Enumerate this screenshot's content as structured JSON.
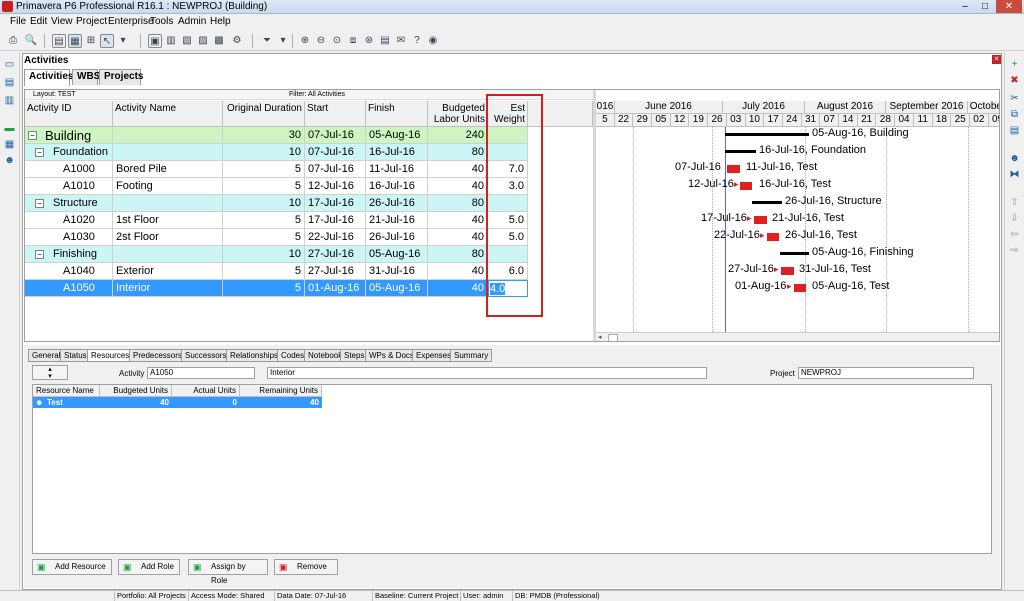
{
  "window": {
    "title": "Primavera P6 Professional R16.1 : NEWPROJ (Building)"
  },
  "menu": [
    "File",
    "Edit",
    "View",
    "Project",
    "Enterprise",
    "Tools",
    "Admin",
    "Help"
  ],
  "panel": {
    "title": "Activities"
  },
  "tabs": [
    "Activities",
    "WBS",
    "Projects"
  ],
  "layout": {
    "label": "Layout: TEST",
    "filter": "Filter: All Activities"
  },
  "columns": {
    "id": "Activity ID",
    "name": "Activity Name",
    "dur": "Original Duration",
    "start": "Start",
    "finish": "Finish",
    "units": "Budgeted Labor Units",
    "weight": "Est Weight"
  },
  "rows": [
    {
      "id": "Building",
      "name": "",
      "dur": "30",
      "start": "07-Jul-16",
      "finish": "05-Aug-16",
      "units": "240",
      "weight": ""
    },
    {
      "id": "Foundation",
      "name": "",
      "dur": "10",
      "start": "07-Jul-16",
      "finish": "16-Jul-16",
      "units": "80",
      "weight": ""
    },
    {
      "id": "A1000",
      "name": "Bored Pile",
      "dur": "5",
      "start": "07-Jul-16",
      "finish": "11-Jul-16",
      "units": "40",
      "weight": "7.0"
    },
    {
      "id": "A1010",
      "name": "Footing",
      "dur": "5",
      "start": "12-Jul-16",
      "finish": "16-Jul-16",
      "units": "40",
      "weight": "3.0"
    },
    {
      "id": "Structure",
      "name": "",
      "dur": "10",
      "start": "17-Jul-16",
      "finish": "26-Jul-16",
      "units": "80",
      "weight": ""
    },
    {
      "id": "A1020",
      "name": "1st Floor",
      "dur": "5",
      "start": "17-Jul-16",
      "finish": "21-Jul-16",
      "units": "40",
      "weight": "5.0"
    },
    {
      "id": "A1030",
      "name": "2st Floor",
      "dur": "5",
      "start": "22-Jul-16",
      "finish": "26-Jul-16",
      "units": "40",
      "weight": "5.0"
    },
    {
      "id": "Finishing",
      "name": "",
      "dur": "10",
      "start": "27-Jul-16",
      "finish": "05-Aug-16",
      "units": "80",
      "weight": ""
    },
    {
      "id": "A1040",
      "name": "Exterior",
      "dur": "5",
      "start": "27-Jul-16",
      "finish": "31-Jul-16",
      "units": "40",
      "weight": "6.0"
    },
    {
      "id": "A1050",
      "name": "Interior",
      "dur": "5",
      "start": "01-Aug-16",
      "finish": "05-Aug-16",
      "units": "40",
      "weight": "4.0"
    }
  ],
  "gantt": {
    "months": [
      "016",
      "June 2016",
      "July 2016",
      "August 2016",
      "September 2016",
      "October"
    ],
    "weeks": [
      "5",
      "22",
      "29",
      "05",
      "12",
      "19",
      "26",
      "03",
      "10",
      "17",
      "24",
      "31",
      "07",
      "14",
      "21",
      "28",
      "04",
      "11",
      "18",
      "25",
      "02",
      "09"
    ],
    "labels": {
      "r0": "05-Aug-16, Building",
      "r1": "16-Jul-16, Foundation",
      "r2s": "07-Jul-16",
      "r2e": "11-Jul-16, Test",
      "r3s": "12-Jul-16",
      "r3e": "16-Jul-16, Test",
      "r4": "26-Jul-16, Structure",
      "r5s": "17-Jul-16",
      "r5e": "21-Jul-16, Test",
      "r6s": "22-Jul-16",
      "r6e": "26-Jul-16, Test",
      "r7": "05-Aug-16, Finishing",
      "r8s": "27-Jul-16",
      "r8e": "31-Jul-16, Test",
      "r9s": "01-Aug-16",
      "r9e": "05-Aug-16, Test"
    }
  },
  "bottom": {
    "tabs": [
      "General",
      "Status",
      "Resources",
      "Predecessors",
      "Successors",
      "Relationships",
      "Codes",
      "Notebook",
      "Steps",
      "WPs & Docs",
      "Expenses",
      "Summary"
    ],
    "activity_label": "Activity",
    "activity_id": "A1050",
    "activity_name": "Interior",
    "project_label": "Project",
    "project": "NEWPROJ",
    "res_cols": [
      "Resource Name",
      "Budgeted Units",
      "Actual Units",
      "Remaining Units"
    ],
    "res_row": [
      "Test",
      "40",
      "0",
      "40"
    ],
    "buttons": [
      "Add Resource",
      "Add Role",
      "Assign by Role",
      "Remove"
    ]
  },
  "status": [
    "Portfolio: All Projects",
    "Access Mode: Shared",
    "Data Date: 07-Jul-16",
    "Baseline: Current Project",
    "User: admin",
    "DB: PMDB (Professional)"
  ]
}
